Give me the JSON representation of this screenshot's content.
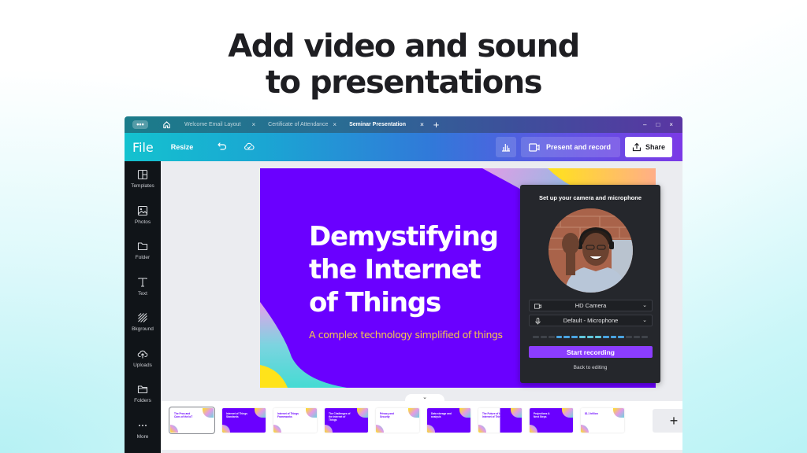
{
  "headline": {
    "line1": "Add video and sound",
    "line2": "to presentations"
  },
  "tabs": {
    "menu_icon": "more-dots-icon",
    "home_icon": "home-icon",
    "items": [
      {
        "label": "Welcome Email Layout",
        "active": false
      },
      {
        "label": "Certificate of Attendance",
        "active": false
      },
      {
        "label": "Seminar Presentation",
        "active": true
      }
    ],
    "close_glyph": "×",
    "new_tab_glyph": "+",
    "window_controls": {
      "minimize": "–",
      "maximize": "□",
      "close": "×"
    }
  },
  "toolbar": {
    "file_label": "File",
    "resize_label": "Resize",
    "present_label": "Present and record",
    "share_label": "Share"
  },
  "sidebar": {
    "items": [
      {
        "label": "Templates",
        "icon": "templates-icon"
      },
      {
        "label": "Photos",
        "icon": "photos-icon"
      },
      {
        "label": "Folder",
        "icon": "folder-icon"
      },
      {
        "label": "Text",
        "icon": "text-icon"
      },
      {
        "label": "Bkground",
        "icon": "background-icon"
      },
      {
        "label": "Uploads",
        "icon": "upload-cloud-icon"
      },
      {
        "label": "Folders",
        "icon": "folders-icon"
      },
      {
        "label": "More",
        "icon": "more-icon"
      }
    ]
  },
  "slide": {
    "title_line1": "Demystifying",
    "title_line2": "the Internet",
    "title_line3": "of Things",
    "subtitle": "A complex technology simplified of things",
    "colors": {
      "background": "#6a00ff",
      "subtitle": "#f5c84b"
    }
  },
  "recorder": {
    "title": "Set up your camera and microphone",
    "camera_value": "HD Camera",
    "microphone_value": "Default - Microphone",
    "level_active_segments": [
      4,
      12
    ],
    "level_total_segments": 15,
    "start_label": "Start recording",
    "back_label": "Back to editing",
    "accent": "#8b3dff"
  },
  "filmstrip": {
    "collapse_glyph": "⌄",
    "thumbnails": [
      {
        "title": "The Pros and Cons of the IoT",
        "theme": "light",
        "selected": true
      },
      {
        "title": "Internet of Things Standards",
        "theme": "dark",
        "selected": false
      },
      {
        "title": "Internet of Things Frameworks",
        "theme": "light",
        "selected": false
      },
      {
        "title": "The Challenges of the Internet of Things",
        "theme": "dark",
        "selected": false
      },
      {
        "title": "Privacy and Security",
        "theme": "light",
        "selected": false
      },
      {
        "title": "Data storage and analysis",
        "theme": "dark",
        "selected": false
      },
      {
        "title": "The Future of the Internet of Things",
        "theme": "split",
        "selected": false
      },
      {
        "title": "Projections & Next Steps",
        "theme": "dark",
        "selected": false
      },
      {
        "title": "$1.1 trillion",
        "theme": "light",
        "selected": false
      }
    ],
    "add_glyph": "+"
  }
}
